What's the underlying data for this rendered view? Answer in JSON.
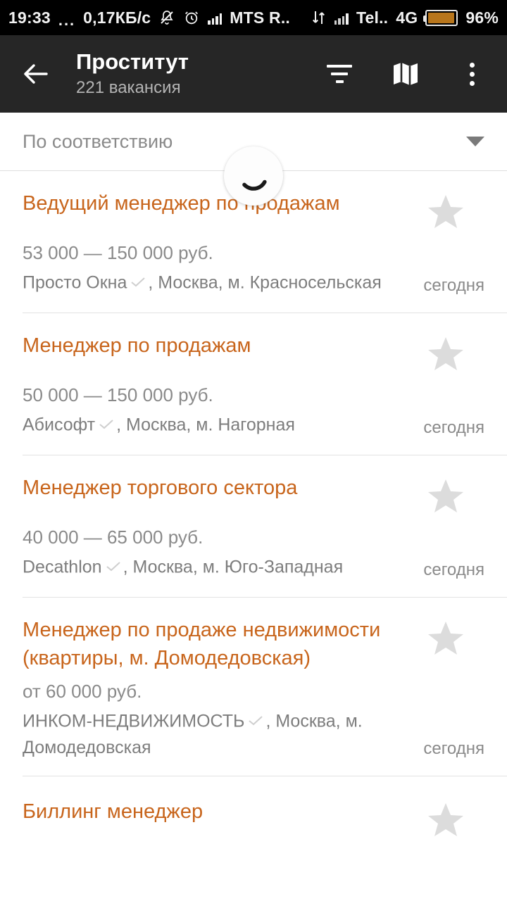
{
  "status_bar": {
    "time": "19:33",
    "dots": "...",
    "data_rate": "0,17КБ/с",
    "icons": [
      "bell-muted-icon",
      "alarm-clock-icon",
      "signal-bars-icon",
      "data-transfer-icon"
    ],
    "carrier_1": "MTS R..",
    "carrier_2": "Tel..",
    "network_type": "4G",
    "battery_percent": "96%",
    "battery_color": "#b8761c"
  },
  "appbar": {
    "back_icon": "back-arrow-icon",
    "title": "Проститут",
    "subtitle": "221 вакансия",
    "filter_icon": "filter-icon",
    "map_icon": "map-icon",
    "overflow_icon": "more-vertical-icon",
    "background": "#262626"
  },
  "sort": {
    "label": "По соответствию",
    "chevron_icon": "chevron-down-icon"
  },
  "loading": {
    "visible": true,
    "icon": "spinner-icon"
  },
  "accent_color": "#c8651c",
  "vacancies": [
    {
      "title": "Ведущий менеджер по продажам",
      "salary": "53 000 — 150 000 руб.",
      "company": "Просто Окна",
      "verified": true,
      "location": ", Москва, м. Красносельская",
      "date": "сегодня",
      "starred": false
    },
    {
      "title": "Менеджер по продажам",
      "salary": "50 000 — 150 000 руб.",
      "company": "Абисофт",
      "verified": true,
      "location": ", Москва, м. Нагорная",
      "date": "сегодня",
      "starred": false
    },
    {
      "title": "Менеджер торгового сектора",
      "salary": "40 000 — 65 000 руб.",
      "company": "Decathlon",
      "verified": true,
      "location": ", Москва, м. Юго-Западная",
      "date": "сегодня",
      "starred": false
    },
    {
      "title": "Менеджер по продаже недвижимости (квартиры, м. Домодедовская)",
      "salary": "от 60 000 руб.",
      "company": "ИНКОМ-НЕДВИЖИМОСТЬ",
      "verified": true,
      "location": ", Москва, м. Домодедовская",
      "date": "сегодня",
      "starred": false
    },
    {
      "title": "Биллинг менеджер",
      "salary": "",
      "company": "",
      "verified": false,
      "location": "",
      "date": "",
      "starred": false
    }
  ]
}
